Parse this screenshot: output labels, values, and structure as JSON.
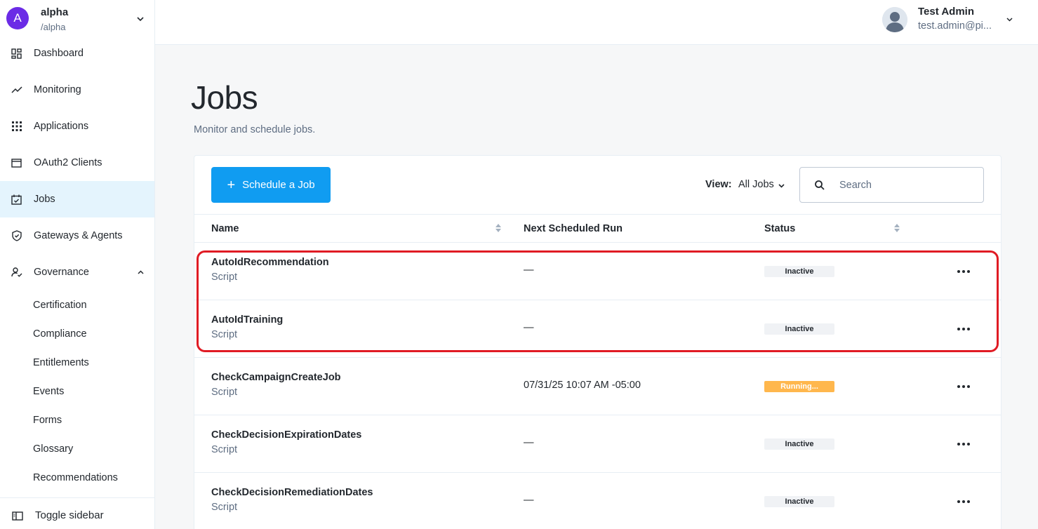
{
  "realm": {
    "initial": "A",
    "name": "alpha",
    "path": "/alpha"
  },
  "nav": {
    "dashboard": "Dashboard",
    "monitoring": "Monitoring",
    "applications": "Applications",
    "oauth2": "OAuth2 Clients",
    "jobs": "Jobs",
    "gateways": "Gateways & Agents",
    "governance": "Governance",
    "governance_items": [
      "Certification",
      "Compliance",
      "Entitlements",
      "Events",
      "Forms",
      "Glossary",
      "Recommendations"
    ],
    "toggle_sidebar": "Toggle sidebar"
  },
  "user": {
    "name": "Test Admin",
    "email": "test.admin@pi..."
  },
  "page": {
    "title": "Jobs",
    "subtitle": "Monitor and schedule jobs."
  },
  "toolbar": {
    "schedule_label": "Schedule a Job",
    "view_label": "View:",
    "view_value": "All Jobs",
    "search_placeholder": "Search"
  },
  "table": {
    "headers": {
      "name": "Name",
      "next_run": "Next Scheduled Run",
      "status": "Status"
    },
    "rows": [
      {
        "name": "AutoIdRecommendation",
        "type": "Script",
        "next_run": "—",
        "status": "Inactive"
      },
      {
        "name": "AutoIdTraining",
        "type": "Script",
        "next_run": "—",
        "status": "Inactive"
      },
      {
        "name": "CheckCampaignCreateJob",
        "type": "Script",
        "next_run": "07/31/25 10:07 AM -05:00",
        "status": "Running..."
      },
      {
        "name": "CheckDecisionExpirationDates",
        "type": "Script",
        "next_run": "—",
        "status": "Inactive"
      },
      {
        "name": "CheckDecisionRemediationDates",
        "type": "Script",
        "next_run": "—",
        "status": "Inactive"
      }
    ]
  },
  "colors": {
    "primary": "#109cf1",
    "active_nav": "#e4f4fd",
    "realm_avatar": "#6b2be6",
    "running": "#ffb74d",
    "highlight": "#e01b24"
  }
}
